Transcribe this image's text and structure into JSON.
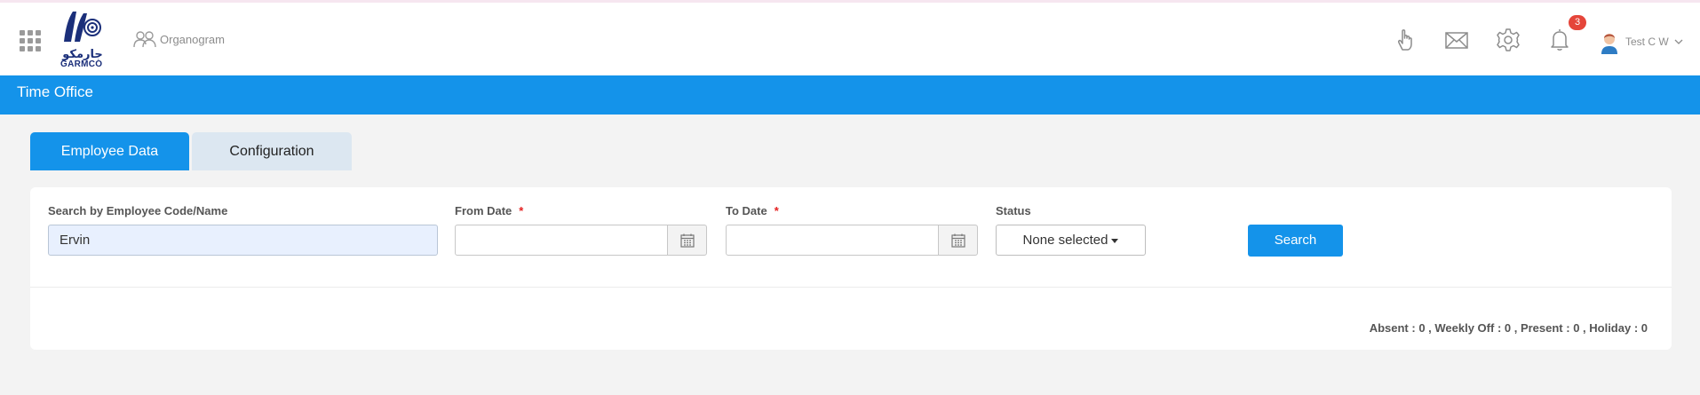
{
  "header": {
    "logo_text": "GARMCO",
    "logo_arabic": "جارمكو",
    "organogram_label": "Organogram",
    "notification_count": "3",
    "user_name": "Test C W",
    "icons": [
      "app-grid-icon",
      "hand-icon",
      "mail-icon",
      "gear-icon",
      "bell-icon",
      "chevron-down-icon"
    ]
  },
  "page": {
    "title": "Time Office"
  },
  "tabs": [
    {
      "label": "Employee Data",
      "active": true
    },
    {
      "label": "Configuration",
      "active": false
    }
  ],
  "filters": {
    "employee_label": "Search by Employee Code/Name",
    "employee_value": "Ervin",
    "from_date_label": "From Date",
    "from_date_value": "",
    "to_date_label": "To Date",
    "to_date_value": "",
    "required_mark": "*",
    "status_label": "Status",
    "status_value": "None selected",
    "search_button": "Search"
  },
  "summary": {
    "text": "Absent : 0 , Weekly Off : 0 , Present : 0 , Holiday : 0"
  },
  "colors": {
    "primary": "#1493ea",
    "tab_inactive": "#dce7f1",
    "badge": "#e5453a",
    "required": "#e52121"
  }
}
